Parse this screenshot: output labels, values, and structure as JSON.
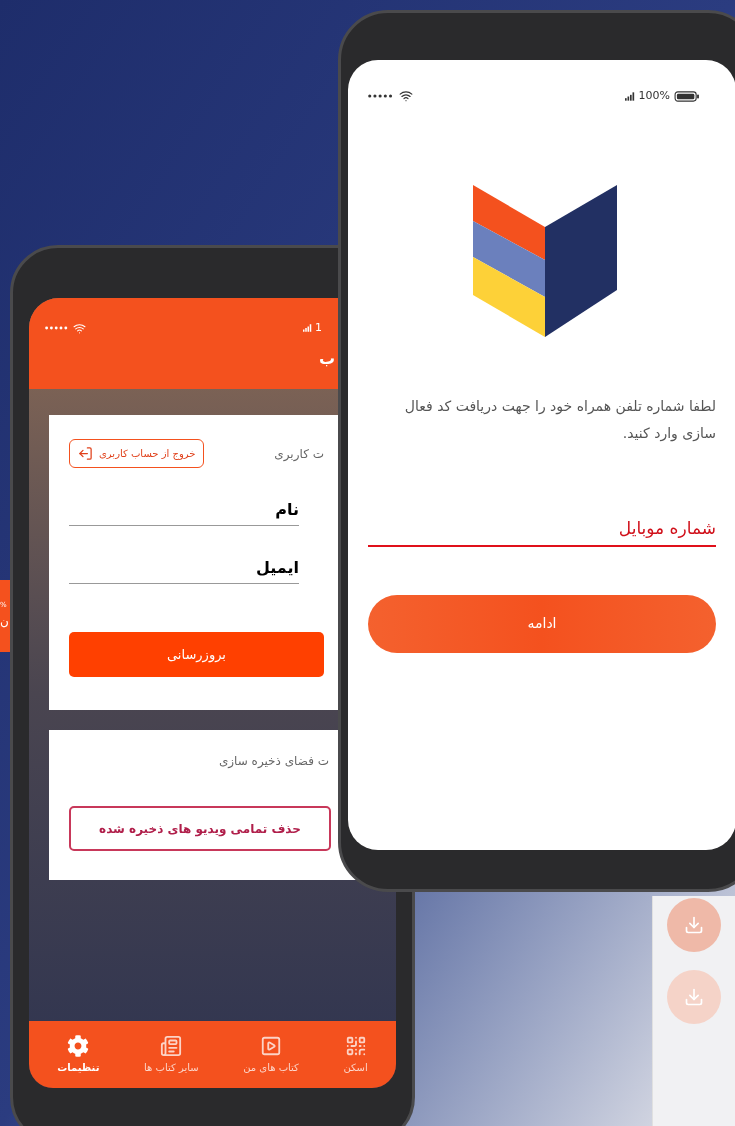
{
  "edge_phone": {
    "texts": [
      "%",
      "ن"
    ]
  },
  "back_phone": {
    "status": {
      "signal_text": "1"
    },
    "header_title": "ب",
    "account_card": {
      "title": "ت کاربری",
      "logout_button": "خروج از حساب کاربری",
      "fields": [
        {
          "placeholder": "نام"
        },
        {
          "placeholder": "ایمیل"
        }
      ],
      "update_button": "بروزرسانی"
    },
    "storage_card": {
      "title": "ت فضای ذخیره سازی",
      "delete_button": "حذف تمامی ویدیو های ذخیره شده"
    },
    "bottom_nav": [
      {
        "kind": "scan",
        "label": "اسکن",
        "selected": false
      },
      {
        "kind": "my_books",
        "label": "کتاب های من",
        "selected": false
      },
      {
        "kind": "other_books",
        "label": "سایر کتاب ها",
        "selected": false
      },
      {
        "kind": "settings",
        "label": "تنظیمات",
        "selected": true
      }
    ]
  },
  "front_phone": {
    "status": {
      "battery_text": "100%"
    },
    "instructions": "لطفا شماره تلفن همراه خود را جهت دریافت کد فعال سازی وارد کنید.",
    "phone_field": {
      "placeholder": "شماره موبایل"
    },
    "continue_button": "ادامه"
  }
}
